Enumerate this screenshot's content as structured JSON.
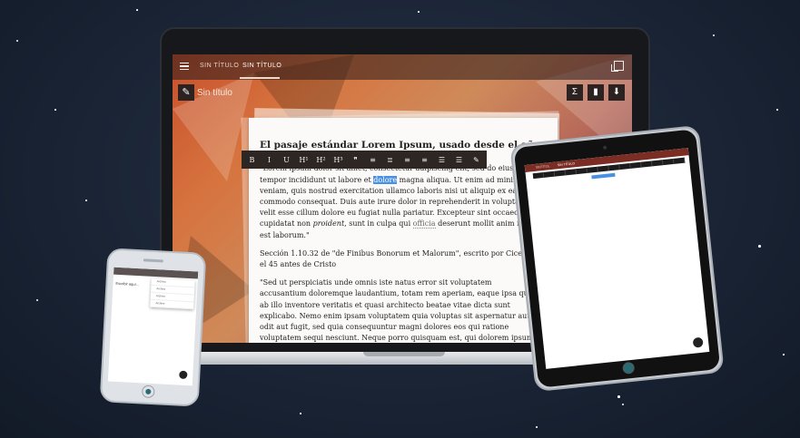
{
  "colors": {
    "background": "#1a2435",
    "editor_gradient_start": "#c7502c",
    "editor_gradient_end": "#5a2a34",
    "toolbar": "#2d2623",
    "selection": "#4a90e2"
  },
  "laptop": {
    "tabs": [
      {
        "label": "SIN TÍTULO",
        "active": false
      },
      {
        "label": "SIN TÍTULO",
        "active": true
      }
    ],
    "document_title": "Sin título",
    "icons": {
      "menu": "menu-icon",
      "copy": "copy-icon",
      "pencil": "pencil-icon",
      "sigma": "sigma-icon",
      "trash": "trash-icon",
      "download": "download-icon"
    },
    "format_toolbar": [
      "B",
      "I",
      "U",
      "H¹",
      "H²",
      "H³",
      "❞",
      "≡",
      "≣",
      "≡",
      "≡",
      "☰",
      "☰",
      "✎"
    ],
    "document": {
      "heading": "El pasaje estándar Lorem Ipsum, usado desde el año 1500",
      "p1_line1": "\"Lorem ipsum dolor sit amet, consectetur adipiscing elit, sed do eiusmod",
      "p1_before_hl": "tempor incididunt ut labore et ",
      "p1_hl": "dolore",
      "p1_after_hl": " magna aliqua. Ut enim ad minim",
      "p1_line3": "veniam, quis nostrud exercitation ullamco laboris nisi ut aliquip ex ea",
      "p1_line4": "commodo consequat. Duis aute irure dolor in reprehenderit in voluptate",
      "p1_line5": "velit esse cillum dolore eu fugiat nulla pariatur. Excepteur sint occaecat",
      "p1_line6_a": "cupidatat non ",
      "p1_line6_em": "proident",
      "p1_line6_b": ", sunt in culpa qui ",
      "p1_line6_dot": "officia",
      "p1_line6_c": " deserunt mollit anim id",
      "p1_line7": "est laborum.\"",
      "p2_line1": "Sección 1.10.32 de \"de Finibus Bonorum et Malorum\", escrito por Cicerón en",
      "p2_line2": "el 45 antes de Cristo",
      "p3_line1": "\"Sed ut perspiciatis unde omnis iste natus error sit voluptatem",
      "p3_line2": "accusantium doloremque laudantium, totam rem aperiam, eaque ipsa quae",
      "p3_line3": "ab illo inventore veritatis et quasi architecto beatae vitae dicta sunt",
      "p3_line4": "explicabo. Nemo enim ipsam voluptatem quia voluptas sit aspernatur aut",
      "p3_line5": "odit aut fugit, sed quia consequuntur magni dolores eos qui ratione",
      "p3_line6": "voluptatem sequi nesciunt. Neque porro quisquam est, qui dolorem ipsum"
    }
  },
  "tablet": {
    "tab1": "SINTÍTUL",
    "tab2": "SIN TÍTULO"
  },
  "phone": {
    "label": "Escribir aquí...",
    "menu_items": [
      "Archivo",
      "Archivo",
      "Archivo",
      "Archivo"
    ]
  }
}
